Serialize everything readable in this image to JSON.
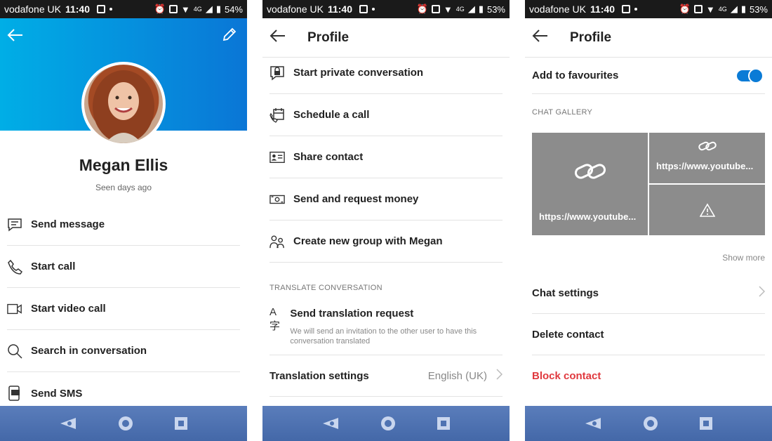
{
  "screens": [
    {
      "status": {
        "carrier": "vodafone UK",
        "time": "11:40",
        "network": "4G",
        "battery": "54%"
      },
      "profile": {
        "name": "Megan Ellis",
        "seen": "Seen days ago"
      },
      "actions": [
        {
          "label": "Send message",
          "icon": "message-icon"
        },
        {
          "label": "Start call",
          "icon": "phone-icon"
        },
        {
          "label": "Start video call",
          "icon": "video-icon"
        },
        {
          "label": "Search in conversation",
          "icon": "search-icon"
        },
        {
          "label": "Send SMS",
          "icon": "sms-icon"
        }
      ]
    },
    {
      "status": {
        "carrier": "vodafone UK",
        "time": "11:40",
        "network": "4G",
        "battery": "53%"
      },
      "header": {
        "title": "Profile"
      },
      "actions": [
        {
          "label": "Start private conversation",
          "icon": "lock-chat-icon"
        },
        {
          "label": "Schedule a call",
          "icon": "calendar-call-icon"
        },
        {
          "label": "Share contact",
          "icon": "contact-card-icon"
        },
        {
          "label": "Send and request money",
          "icon": "money-icon"
        },
        {
          "label": "Create new group with Megan",
          "icon": "group-icon"
        }
      ],
      "translate": {
        "section": "TRANSLATE CONVERSATION",
        "request_title": "Send translation request",
        "request_desc": "We will send an invitation to the other user to have this conversation translated",
        "settings_label": "Translation settings",
        "settings_value": "English (UK)"
      }
    },
    {
      "status": {
        "carrier": "vodafone UK",
        "time": "11:40",
        "network": "4G",
        "battery": "53%"
      },
      "header": {
        "title": "Profile"
      },
      "favourites": {
        "label": "Add to favourites",
        "enabled": true
      },
      "gallery": {
        "section": "CHAT GALLERY",
        "items": [
          {
            "text": "https://www.youtube...",
            "icon": "link-icon"
          },
          {
            "text": "https://www.youtube...",
            "icon": "link-icon"
          },
          {
            "text": "",
            "icon": "warning-icon"
          }
        ],
        "show_more": "Show more"
      },
      "settings": [
        {
          "label": "Chat settings"
        },
        {
          "label": "Delete contact"
        },
        {
          "label": "Block contact"
        }
      ]
    }
  ],
  "colors": {
    "accent": "#0a7bd6",
    "header_gradient_start": "#00aee6",
    "danger": "#e0393e",
    "navbar": "#4f73b2",
    "gallery_tile": "#8c8c8c"
  }
}
